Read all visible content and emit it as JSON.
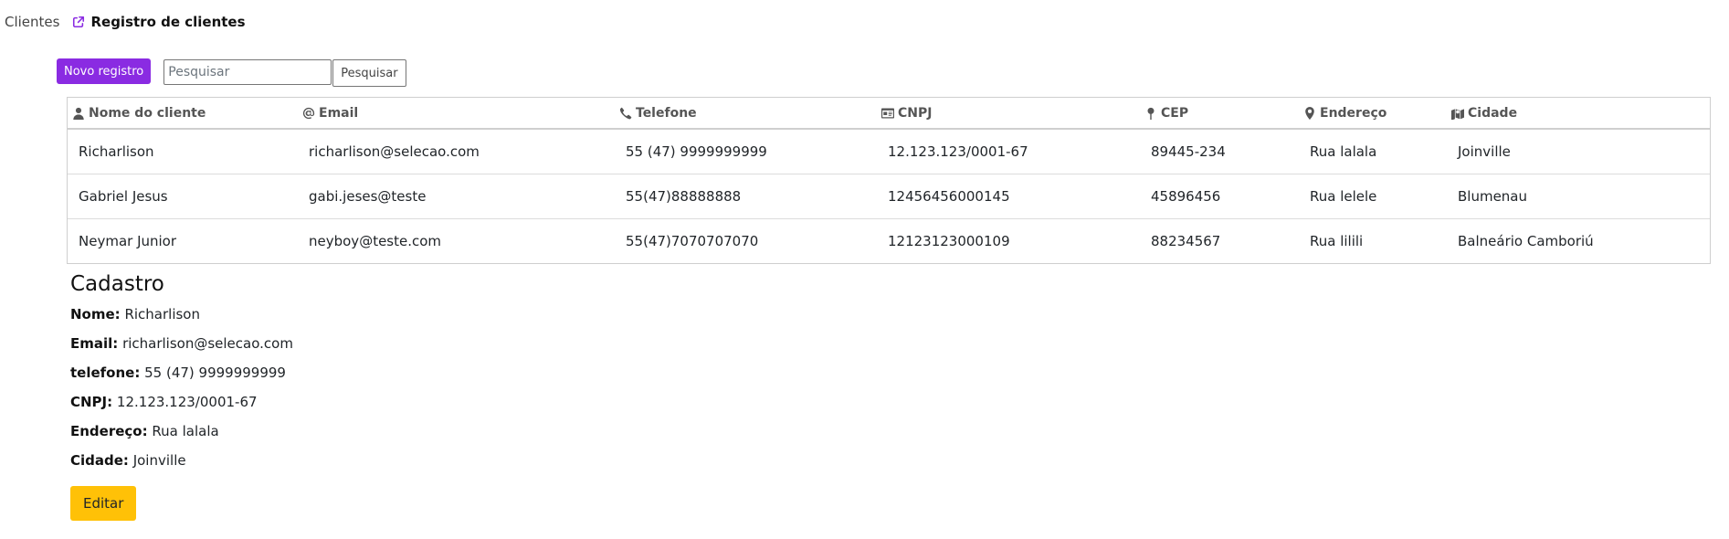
{
  "nav": {
    "clients_label": "Clientes",
    "registry_label": "Registro de clientes"
  },
  "toolbar": {
    "new_label": "Novo registro",
    "search_placeholder": "Pesquisar",
    "search_value": "",
    "search_button": "Pesquisar"
  },
  "table": {
    "headers": {
      "name": "Nome do cliente",
      "email": "Email",
      "phone": "Telefone",
      "cnpj": "CNPJ",
      "cep": "CEP",
      "address": "Endereço",
      "city": "Cidade"
    },
    "rows": [
      {
        "name": "Richarlison",
        "email": "richarlison@selecao.com",
        "phone": "55 (47) 9999999999",
        "cnpj": "12.123.123/0001-67",
        "cep": "89445-234",
        "address": "Rua lalala",
        "city": "Joinville"
      },
      {
        "name": "Gabriel Jesus",
        "email": "gabi.jeses@teste",
        "phone": "55(47)88888888",
        "cnpj": "12456456000145",
        "cep": "45896456",
        "address": "Rua lelele",
        "city": "Blumenau"
      },
      {
        "name": "Neymar Junior",
        "email": "neyboy@teste.com",
        "phone": "55(47)7070707070",
        "cnpj": "12123123000109",
        "cep": "88234567",
        "address": "Rua lilili",
        "city": "Balneário Camboriú"
      }
    ]
  },
  "detail": {
    "title": "Cadastro",
    "name_label": "Nome:",
    "name": "Richarlison",
    "email_label": "Email:",
    "email": "richarlison@selecao.com",
    "phone_label": "telefone:",
    "phone": "55 (47) 9999999999",
    "cnpj_label": "CNPJ:",
    "cnpj": "12.123.123/0001-67",
    "address_label": "Endereço:",
    "address": "Rua lalala",
    "city_label": "Cidade:",
    "city": "Joinville",
    "edit_label": "Editar"
  },
  "colors": {
    "primary": "#8a2be2",
    "warning": "#ffc107"
  },
  "icons": {
    "registry": "external-link-icon",
    "name": "user-icon",
    "email": "at-icon",
    "phone": "phone-icon",
    "cnpj": "id-card-icon",
    "cep": "map-pin-icon",
    "address": "location-marker-icon",
    "city": "map-icon"
  }
}
